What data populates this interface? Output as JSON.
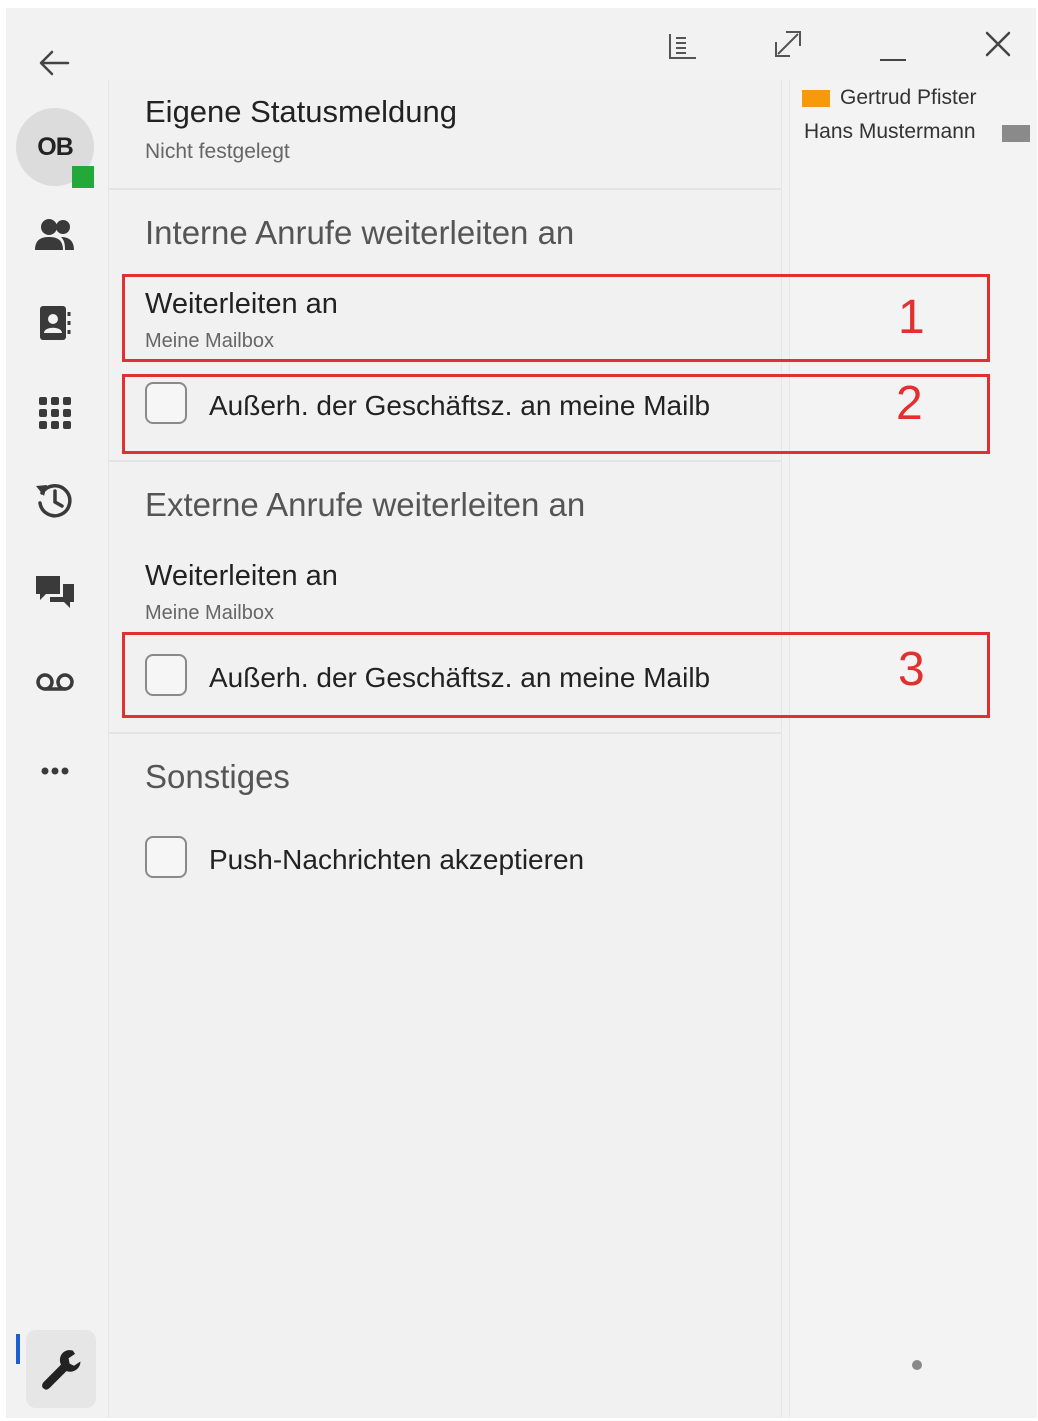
{
  "titlebar": {
    "back_icon": "arrow-left-icon",
    "icons": [
      "list-view-icon",
      "restore-window-icon",
      "minimize-icon",
      "close-icon"
    ]
  },
  "user": {
    "initials": "OB",
    "presence_color": "#22a93a"
  },
  "sidebar": {
    "items": [
      {
        "icon": "people-icon"
      },
      {
        "icon": "contact-card-icon"
      },
      {
        "icon": "dialpad-icon"
      },
      {
        "icon": "history-icon"
      },
      {
        "icon": "chat-icon"
      },
      {
        "icon": "voicemail-icon"
      },
      {
        "icon": "more-icon"
      }
    ],
    "settings_icon": "wrench-icon",
    "active_indicator_color": "#1a5fd1"
  },
  "status_message": {
    "title": "Eigene Statusmeldung",
    "value": "Nicht festgelegt"
  },
  "internal": {
    "heading": "Interne Anrufe weiterleiten an",
    "forward_title": "Weiterleiten an",
    "forward_value": "Meine Mailbox",
    "after_hours_label": "Außerh. der Geschäftsz. an meine Mailb",
    "after_hours_checked": false
  },
  "external": {
    "heading": "Externe Anrufe weiterleiten an",
    "forward_title": "Weiterleiten an",
    "forward_value": "Meine Mailbox",
    "after_hours_label": "Außerh. der Geschäftsz. an meine Mailb",
    "after_hours_checked": false
  },
  "other": {
    "heading": "Sonstiges",
    "push_label": "Push-Nachrichten akzeptieren",
    "push_checked": false
  },
  "contacts": [
    {
      "name": "Gertrud Pfister",
      "color": "#f59a0a"
    },
    {
      "name": "Hans Mustermann",
      "color": "#8a8a8a"
    }
  ],
  "annotations": [
    "1",
    "2",
    "3"
  ],
  "annotation_color": "#e23030"
}
